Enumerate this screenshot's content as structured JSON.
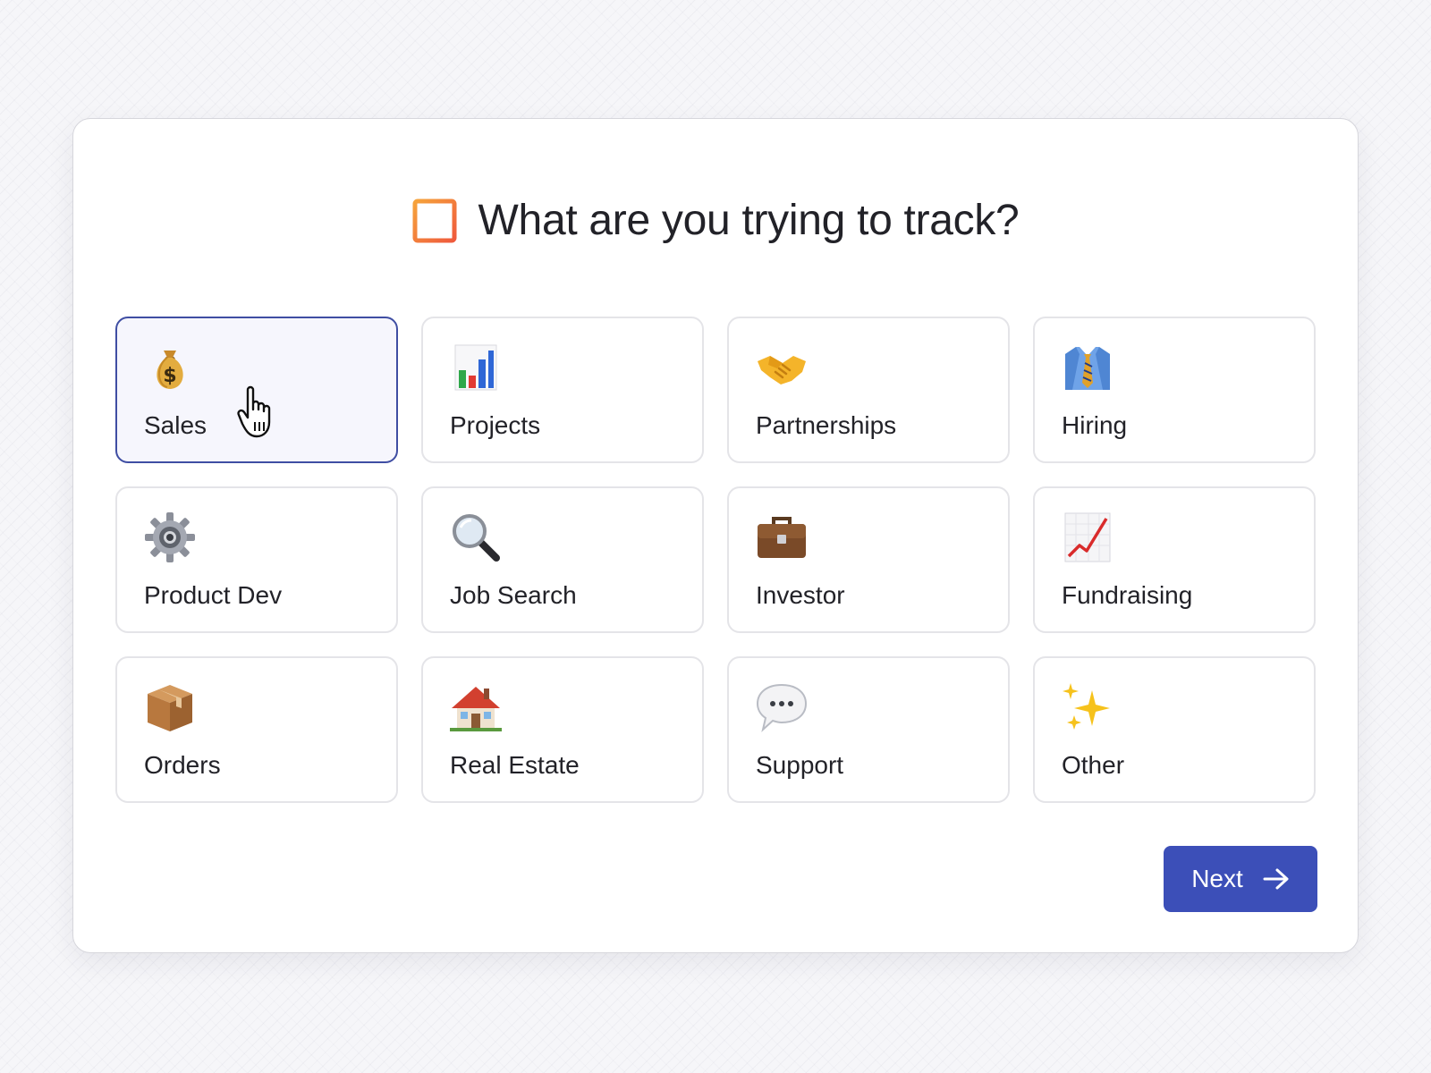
{
  "title": "What are you trying to track?",
  "title_icon": "layout-icon",
  "accent_color": "#3c4fb8",
  "selected_option": "Sales",
  "options": [
    {
      "label": "Sales",
      "icon": "money-bag-icon",
      "selected": true
    },
    {
      "label": "Projects",
      "icon": "bar-chart-icon",
      "selected": false
    },
    {
      "label": "Partnerships",
      "icon": "handshake-icon",
      "selected": false
    },
    {
      "label": "Hiring",
      "icon": "shirt-tie-icon",
      "selected": false
    },
    {
      "label": "Product Dev",
      "icon": "gear-icon",
      "selected": false
    },
    {
      "label": "Job Search",
      "icon": "magnifier-icon",
      "selected": false
    },
    {
      "label": "Investor",
      "icon": "briefcase-icon",
      "selected": false
    },
    {
      "label": "Fundraising",
      "icon": "chart-increasing-icon",
      "selected": false
    },
    {
      "label": "Orders",
      "icon": "package-icon",
      "selected": false
    },
    {
      "label": "Real Estate",
      "icon": "house-icon",
      "selected": false
    },
    {
      "label": "Support",
      "icon": "speech-bubble-icon",
      "selected": false
    },
    {
      "label": "Other",
      "icon": "sparkles-icon",
      "selected": false
    }
  ],
  "next_button": {
    "label": "Next",
    "icon": "arrow-right-icon"
  }
}
